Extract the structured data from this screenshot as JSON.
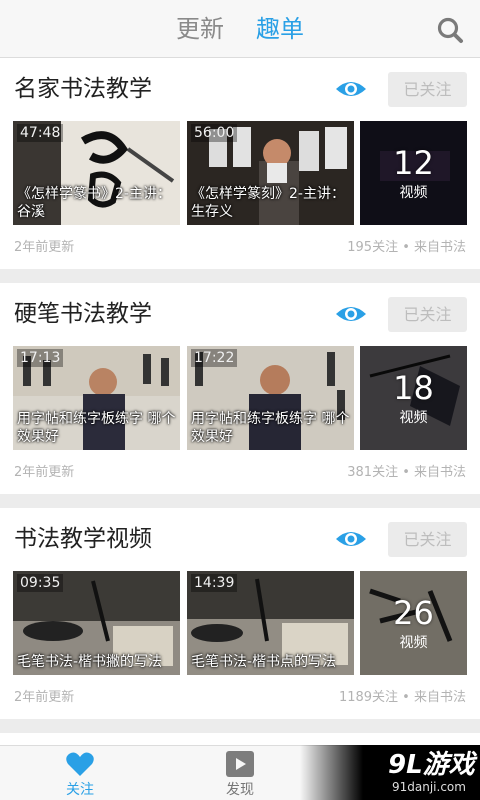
{
  "header": {
    "tabs": [
      {
        "label": "更新",
        "active": false
      },
      {
        "label": "趣单",
        "active": true
      }
    ],
    "search_icon": "search-icon",
    "accent_color": "#2aa0e6"
  },
  "cards": [
    {
      "title": "名家书法教学",
      "follow_label": "已关注",
      "videos": [
        {
          "duration": "47:48",
          "title": "《怎样学篆书》2-主讲：谷溪"
        },
        {
          "duration": "56:00",
          "title": "《怎样学篆刻》2-主讲：生存义"
        }
      ],
      "more": {
        "count": "12",
        "label": "视频"
      },
      "updated": "2年前更新",
      "stats": "195关注 • 来自书法"
    },
    {
      "title": "硬笔书法教学",
      "follow_label": "已关注",
      "videos": [
        {
          "duration": "17:13",
          "title": "用字帖和练字板练字 哪个效果好"
        },
        {
          "duration": "17:22",
          "title": "用字帖和练字板练字 哪个效果好"
        }
      ],
      "more": {
        "count": "18",
        "label": "视频"
      },
      "updated": "2年前更新",
      "stats": "381关注 • 来自书法"
    },
    {
      "title": "书法教学视频",
      "follow_label": "已关注",
      "videos": [
        {
          "duration": "09:35",
          "title": "毛笔书法-楷书撇的写法"
        },
        {
          "duration": "14:39",
          "title": "毛笔书法-楷书点的写法"
        }
      ],
      "more": {
        "count": "26",
        "label": "视频"
      },
      "updated": "2年前更新",
      "stats": "1189关注 • 来自书法"
    }
  ],
  "bottom_nav": [
    {
      "label": "关注",
      "icon": "heart-icon",
      "active": true
    },
    {
      "label": "发现",
      "icon": "play-icon",
      "active": false
    }
  ],
  "watermark": {
    "logo": "9L游戏",
    "url": "91danji.com"
  }
}
